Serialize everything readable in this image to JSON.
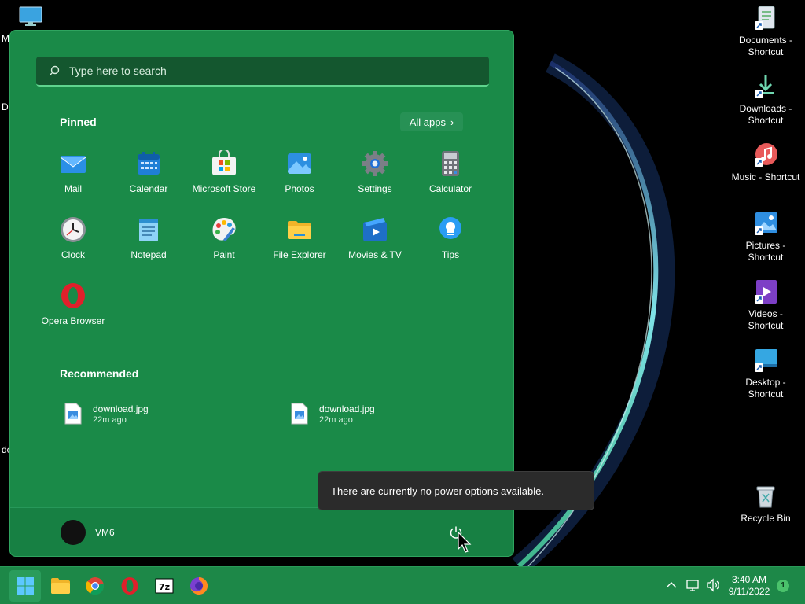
{
  "desktop": {
    "left_partial_labels": [
      "M",
      "Da",
      "do"
    ],
    "icons": [
      {
        "label": "Documents - Shortcut",
        "icon": "documents-icon"
      },
      {
        "label": "Downloads - Shortcut",
        "icon": "downloads-icon"
      },
      {
        "label": "Music - Shortcut",
        "icon": "music-icon"
      },
      {
        "label": "Pictures - Shortcut",
        "icon": "pictures-icon"
      },
      {
        "label": "Videos - Shortcut",
        "icon": "videos-icon"
      },
      {
        "label": "Desktop - Shortcut",
        "icon": "desktop-icon"
      }
    ],
    "recycle_bin": "Recycle Bin"
  },
  "start_menu": {
    "search_placeholder": "Type here to search",
    "pinned_title": "Pinned",
    "all_apps_label": "All apps",
    "pinned": [
      {
        "label": "Mail",
        "icon": "mail-icon"
      },
      {
        "label": "Calendar",
        "icon": "calendar-icon"
      },
      {
        "label": "Microsoft Store",
        "icon": "store-icon"
      },
      {
        "label": "Photos",
        "icon": "photos-icon"
      },
      {
        "label": "Settings",
        "icon": "gear-icon"
      },
      {
        "label": "Calculator",
        "icon": "calculator-icon"
      },
      {
        "label": "Clock",
        "icon": "clock-icon"
      },
      {
        "label": "Notepad",
        "icon": "notepad-icon"
      },
      {
        "label": "Paint",
        "icon": "paint-icon"
      },
      {
        "label": "File Explorer",
        "icon": "folder-icon"
      },
      {
        "label": "Movies & TV",
        "icon": "movies-icon"
      },
      {
        "label": "Tips",
        "icon": "tips-icon"
      },
      {
        "label": "Opera Browser",
        "icon": "opera-icon"
      }
    ],
    "recommended_title": "Recommended",
    "recommended": [
      {
        "name": "download.jpg",
        "time": "22m ago"
      },
      {
        "name": "download.jpg",
        "time": "22m ago"
      }
    ],
    "user_name": "VM6"
  },
  "tooltip": "There are currently no power options available.",
  "taskbar": {
    "time": "3:40 AM",
    "date": "9/11/2022",
    "notification_count": "1"
  }
}
